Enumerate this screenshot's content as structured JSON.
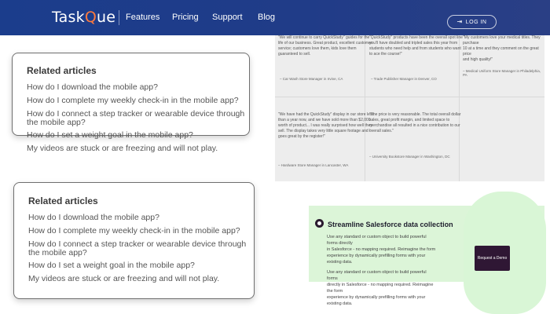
{
  "header": {
    "logo_main": "Task",
    "logo_q": "Q",
    "logo_rest": "ue",
    "nav": [
      "Features",
      "Pricing",
      "Support",
      "Blog"
    ],
    "login_label": "LOG IN"
  },
  "related_top": {
    "title": "Related articles",
    "links": [
      "How do I download the mobile app?",
      "How do I complete my weekly check-in in the mobile app?",
      "How do I connect a step tracker or wearable device through",
      "the mobile app?",
      "How do I set a weight goal in the mobile app?",
      "My videos are stuck or are freezing and will not play."
    ]
  },
  "related_bottom": {
    "title": "Related articles",
    "links": [
      "How do I download the mobile app?",
      "How do I complete my weekly check-in in the mobile app?",
      "How do I connect a step tracker or wearable device through",
      "the mobile app?",
      "How do I set a weight goal in the mobile app?",
      "My videos are stuck or are freezing and will not play."
    ]
  },
  "testimonials": [
    {
      "quote": [
        "\"We will continue to carry QuickStudy\" guides for the",
        "life of our business. Great product, excellent customer",
        "service; customers love them, kids love them",
        "guaranteed to sell."
      ],
      "author": "– Car Wash Store Manager in Irvine, CA"
    },
    {
      "quote": [
        "\"QuickStudy\" products have been the overall spot line",
        "you'll have doubled and tripled sales this year from",
        "students who need help and from students who want",
        "to ace the course!\""
      ],
      "author": "– Trade Publisher Manager in Denver, CO"
    },
    {
      "quote": [
        "\"My customers love your medical titles. They purchase",
        "10 at a time and they comment on the great price",
        "and high quality!\""
      ],
      "author": "– Medical Uniform Store Manager in Philadelphia, PA"
    },
    {
      "quote": [
        "\"We have had the QuickStudy\" display in our store less",
        "than a year now, and we have sold more than $2,000",
        "worth of product... I was really surprised how well they",
        "sell. The display takes very little square footage and I",
        "goes great by the register!\""
      ],
      "author": "– Hardware Store Manager in Lancaster, WA"
    },
    {
      "quote": [
        "\"The price is very reasonable. The total overall dollar",
        "sales, great profit margin, and limited space to",
        "merchandise all resulted in a nice contribution to our",
        "overall sales.\""
      ],
      "author": "– University Bookstore Manager in Washington, DC"
    }
  ],
  "streamline": {
    "title": "Streamline Salesforce data collection",
    "paragraph1": [
      "Use any standard or custom object to build powerful forms directly",
      "in Salesforce - no mapping required. Reimagine the form",
      "experience by dynamically prefilling forms with your existing data."
    ],
    "paragraph2": [
      "Use any standard or custom object to build powerful forms",
      "directly in Salesforce - no mapping required. Reimagine the form",
      "experience by dynamically prefilling forms with your existing data."
    ],
    "demo_label": "Request a Demo"
  }
}
